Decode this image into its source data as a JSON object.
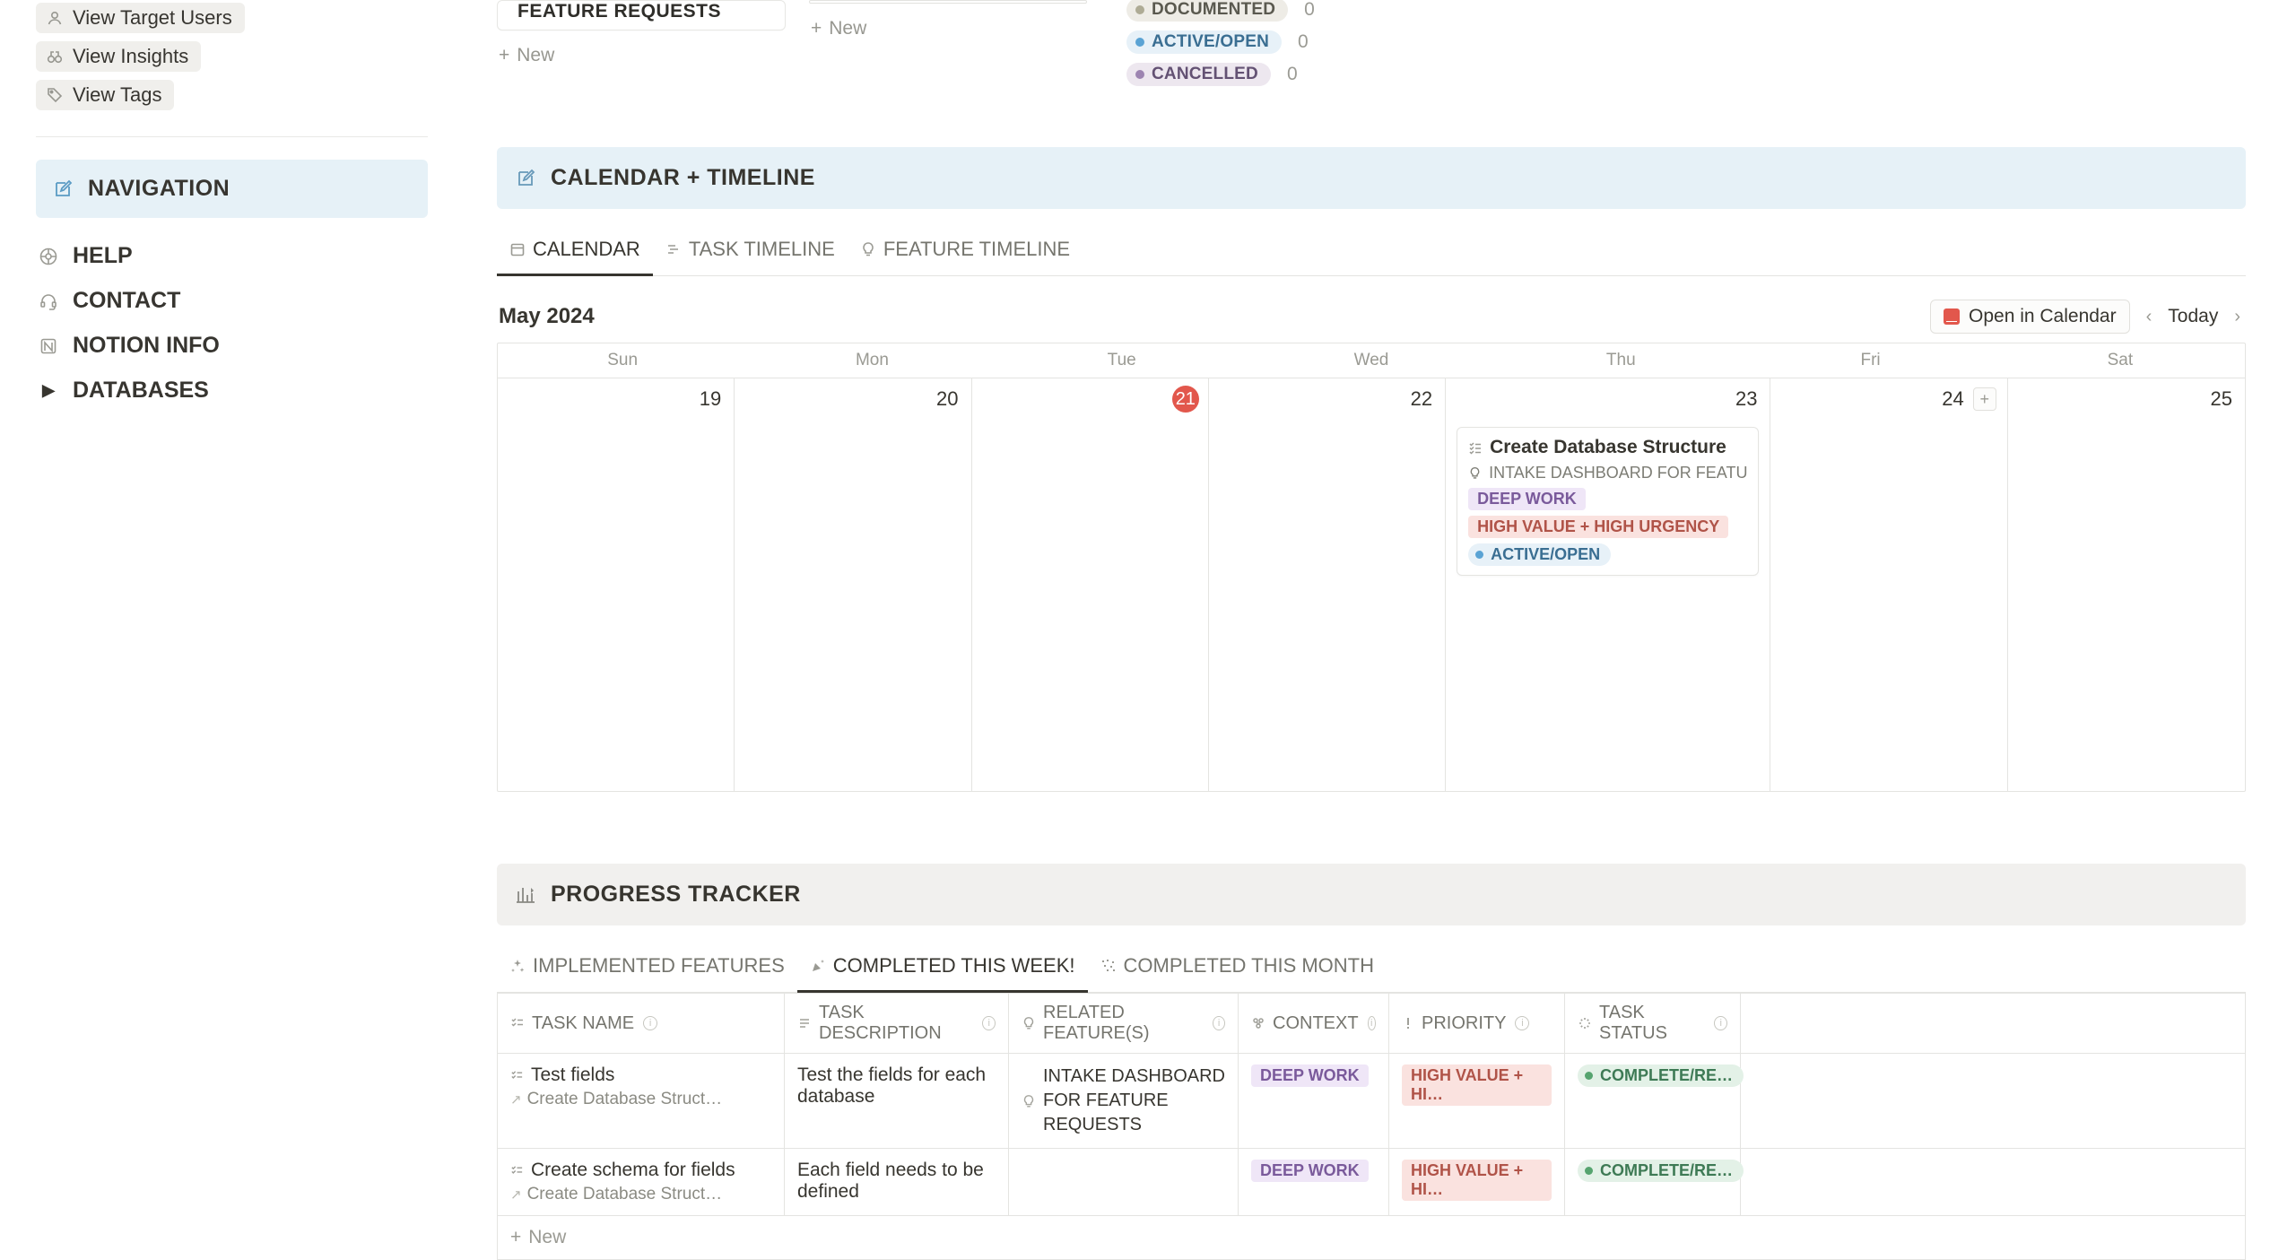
{
  "sidebar": {
    "buttons": [
      {
        "label": "View Target Users",
        "icon": "person"
      },
      {
        "label": "View Insights",
        "icon": "binoc"
      },
      {
        "label": "View Tags",
        "icon": "tag"
      }
    ],
    "nav": "NAVIGATION",
    "links": [
      {
        "label": "HELP",
        "icon": "help"
      },
      {
        "label": "CONTACT",
        "icon": "headset"
      },
      {
        "label": "NOTION INFO",
        "icon": "notion"
      },
      {
        "label": "DATABASES",
        "icon": "tri"
      }
    ]
  },
  "top": {
    "feature_card": "FEATURE REQUESTS",
    "new": "New",
    "statuses": [
      {
        "label": "DOCUMENTED",
        "count": 0,
        "cls": "doc"
      },
      {
        "label": "ACTIVE/OPEN",
        "count": 0,
        "cls": "active"
      },
      {
        "label": "CANCELLED",
        "count": 0,
        "cls": "cancel"
      }
    ]
  },
  "cal": {
    "header": "CALENDAR + TIMELINE",
    "tabs": [
      "CALENDAR",
      "TASK TIMELINE",
      "FEATURE TIMELINE"
    ],
    "month": "May 2024",
    "open": "Open in Calendar",
    "today": "Today",
    "days": [
      "Sun",
      "Mon",
      "Tue",
      "Wed",
      "Thu",
      "Fri",
      "Sat"
    ],
    "dates": [
      19,
      20,
      21,
      22,
      23,
      24,
      25
    ],
    "today_index": 2,
    "event": {
      "title": "Create Database Structure",
      "sub": "INTAKE DASHBOARD FOR FEATU",
      "context": "DEEP WORK",
      "priority": "HIGH VALUE + HIGH URGENCY",
      "status": "ACTIVE/OPEN"
    }
  },
  "progress": {
    "header": "PROGRESS TRACKER",
    "tabs": [
      "IMPLEMENTED FEATURES",
      "COMPLETED THIS WEEK!",
      "COMPLETED THIS MONTH"
    ],
    "active_tab": 1,
    "columns": [
      "TASK NAME",
      "TASK DESCRIPTION",
      "RELATED FEATURE(S)",
      "CONTEXT",
      "PRIORITY",
      "TASK STATUS"
    ],
    "rows": [
      {
        "name": "Test fields",
        "parent": "Create Database Struct…",
        "desc": "Test the fields for each database",
        "rel": "INTAKE DASHBOARD FOR FEATURE REQUESTS",
        "context": "DEEP WORK",
        "priority": "HIGH VALUE + HI…",
        "status": "COMPLETE/RE…"
      },
      {
        "name": "Create schema for fields",
        "parent": "Create Database Struct…",
        "desc": "Each field needs to be defined",
        "rel": "",
        "context": "DEEP WORK",
        "priority": "HIGH VALUE + HI…",
        "status": "COMPLETE/RE…"
      }
    ],
    "new": "New"
  }
}
